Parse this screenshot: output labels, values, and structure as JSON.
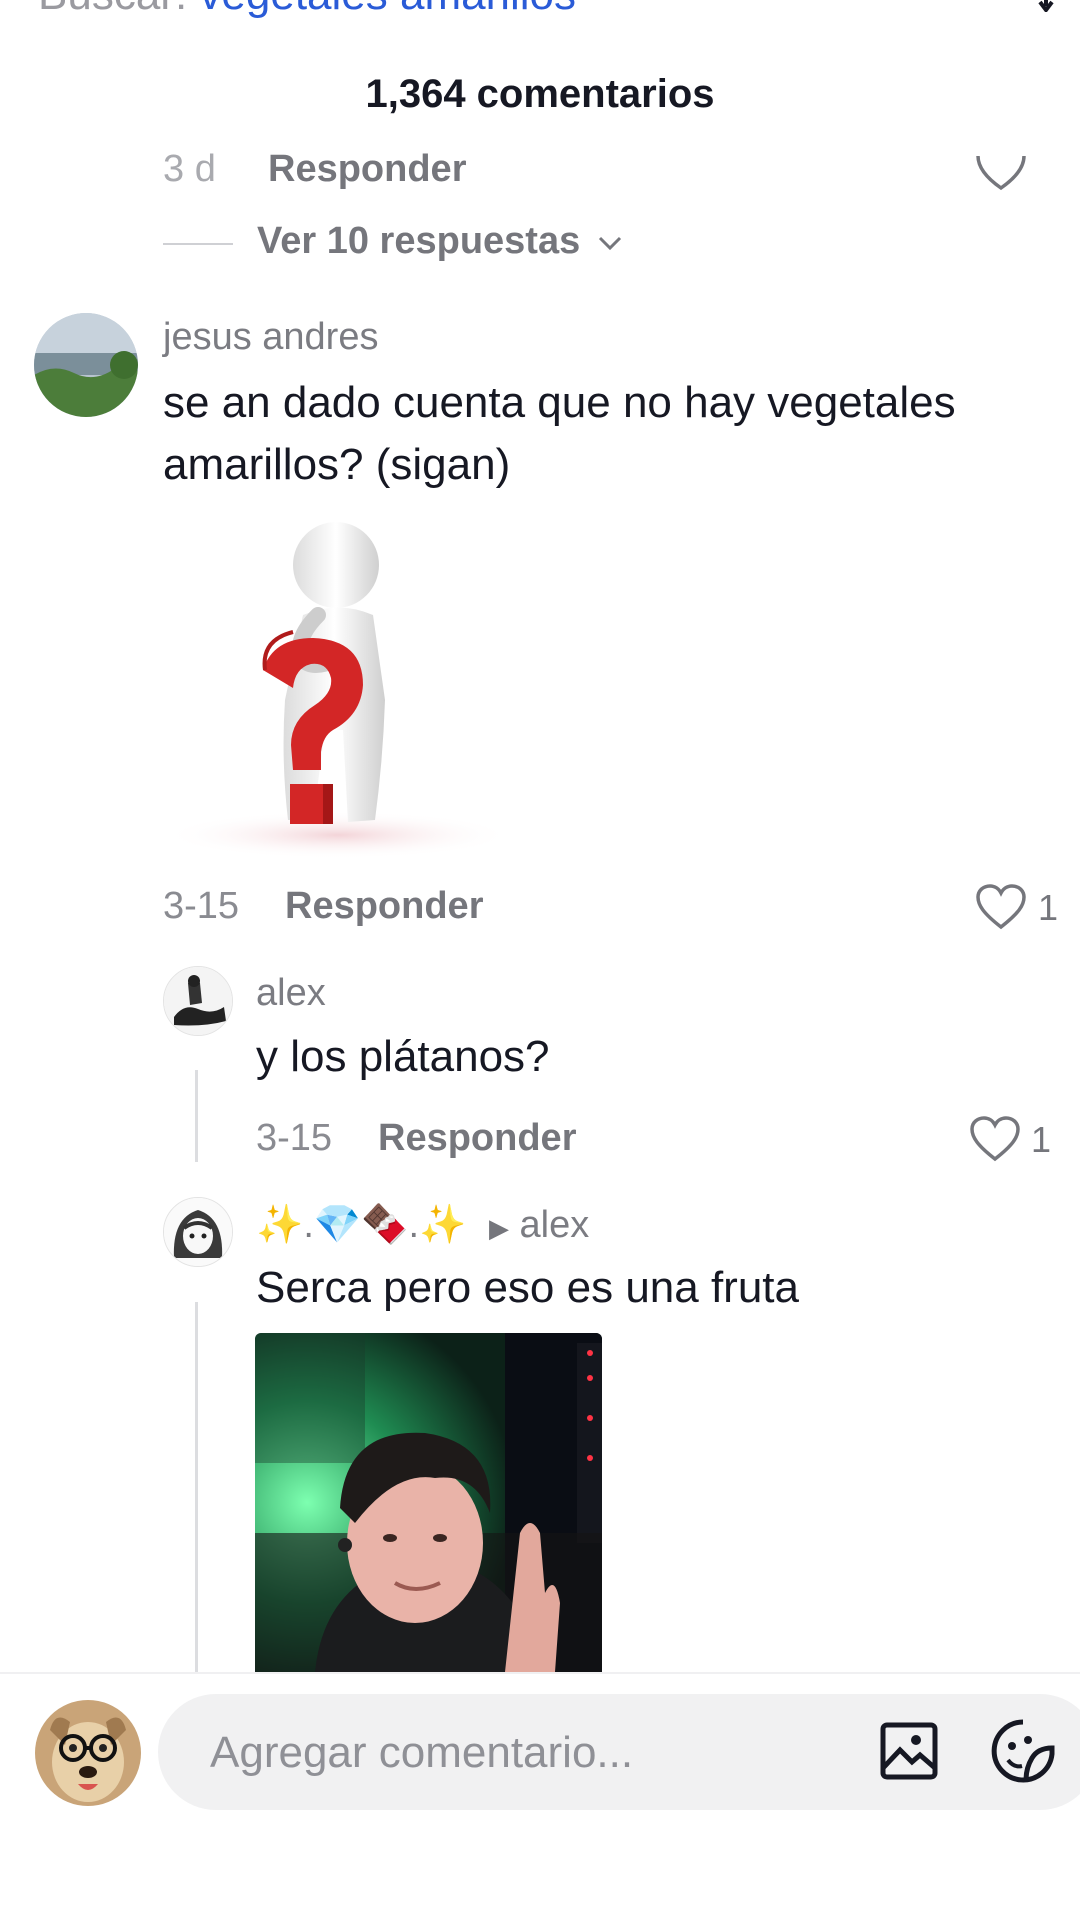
{
  "search": {
    "prefix": "Buscar:",
    "query": "vegetales amarillos"
  },
  "header": {
    "comments_count": "1,364 comentarios"
  },
  "prev_comment": {
    "time": "3 d",
    "reply_label": "Responder"
  },
  "view_replies": {
    "label": "Ver 10 respuestas"
  },
  "comments": [
    {
      "user": "jesus andres",
      "text_line1": "se an dado cuenta que no hay vegetales",
      "text_line2": "amarillos? (sigan)",
      "time": "3-15",
      "reply_label": "Responder",
      "likes": "1"
    }
  ],
  "replies": [
    {
      "user": "alex",
      "text": "y los plátanos?",
      "time": "3-15",
      "reply_label": "Responder",
      "likes": "1"
    },
    {
      "user": "✨.💎🍫.✨",
      "reply_to": "alex",
      "text": "Serca pero eso es una fruta"
    }
  ],
  "composer": {
    "placeholder": "Agregar comentario..."
  },
  "colors": {
    "accent": "#2a5bd7",
    "question_mark": "#d32626",
    "muted": "#75767c"
  }
}
